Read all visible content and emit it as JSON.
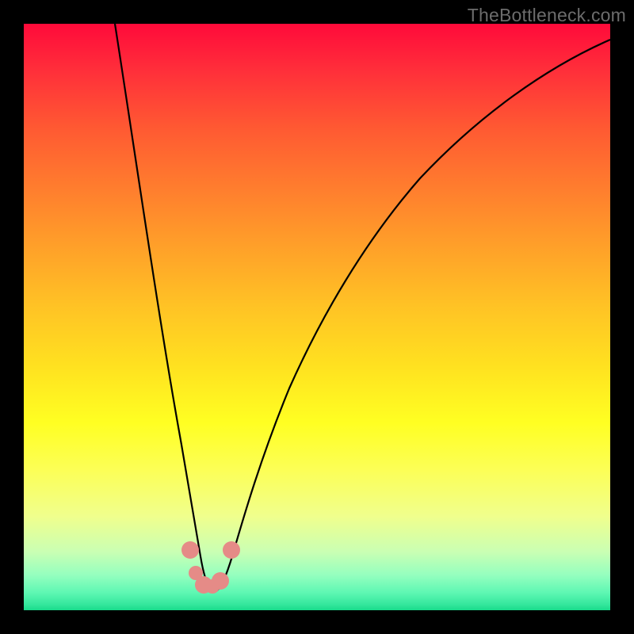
{
  "watermark": "TheBottleneck.com",
  "chart_data": {
    "type": "line",
    "title": "",
    "xlabel": "",
    "ylabel": "",
    "xlim": [
      0,
      100
    ],
    "ylim": [
      0,
      100
    ],
    "grid": false,
    "legend": false,
    "series": [
      {
        "name": "curve",
        "x": [
          15.5,
          17,
          19,
          21,
          23,
          25,
          26.5,
          28,
          29,
          30,
          31,
          32,
          33,
          34,
          36,
          38,
          41,
          45,
          50,
          56,
          63,
          72,
          82,
          92,
          100
        ],
        "values": [
          100,
          90,
          78,
          66,
          54,
          42,
          32,
          22,
          14,
          8,
          4,
          2.5,
          2.5,
          4,
          9,
          16,
          25,
          35,
          45,
          55,
          64,
          73,
          81,
          88,
          92
        ]
      }
    ],
    "annotations": [
      {
        "type": "dot",
        "x": 28.2,
        "y": 9.0,
        "size": "big",
        "color": "#e58b87"
      },
      {
        "type": "dot",
        "x": 29.1,
        "y": 5.5,
        "size": "med",
        "color": "#e58b87"
      },
      {
        "type": "dot",
        "x": 30.6,
        "y": 3.2,
        "size": "big",
        "color": "#e58b87"
      },
      {
        "type": "dot",
        "x": 32.0,
        "y": 3.0,
        "size": "med",
        "color": "#e58b87"
      },
      {
        "type": "dot",
        "x": 33.4,
        "y": 4.0,
        "size": "big",
        "color": "#e58b87"
      },
      {
        "type": "dot",
        "x": 35.2,
        "y": 9.0,
        "size": "big",
        "color": "#e58b87"
      }
    ]
  }
}
